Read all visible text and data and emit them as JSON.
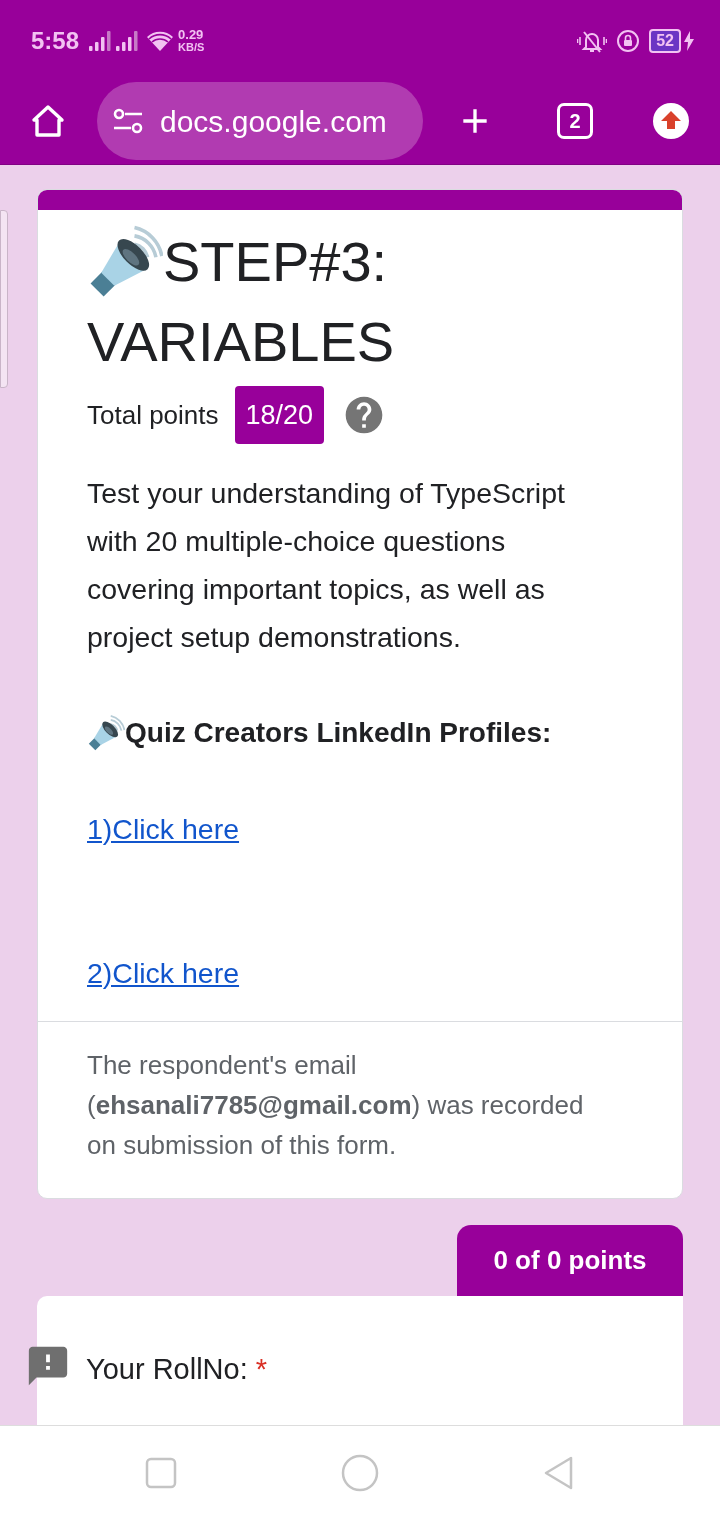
{
  "status_bar": {
    "time": "5:58",
    "speed_value": "0.29",
    "speed_unit": "KB/S",
    "battery": "52"
  },
  "browser_toolbar": {
    "url": "docs.google.com",
    "tab_count": "2"
  },
  "form_header": {
    "title_lines": [
      "STEP#3:",
      "VARIABLES"
    ],
    "total_points_label": "Total points",
    "score": "18/20",
    "description": "Test your understanding of TypeScript with 20 multiple-choice questions covering important topics, as well as project setup demonstrations.",
    "section_heading": "Quiz Creators LinkedIn Profiles:",
    "links": [
      "1)Click here",
      "2)Click here"
    ],
    "email_note": "The respondent's email (**ehsanali7785@gmail.com**) was recorded on submission of this form."
  },
  "question_card": {
    "points": "0 of 0 points",
    "question": "Your RollNo:",
    "required_mark": "*"
  }
}
